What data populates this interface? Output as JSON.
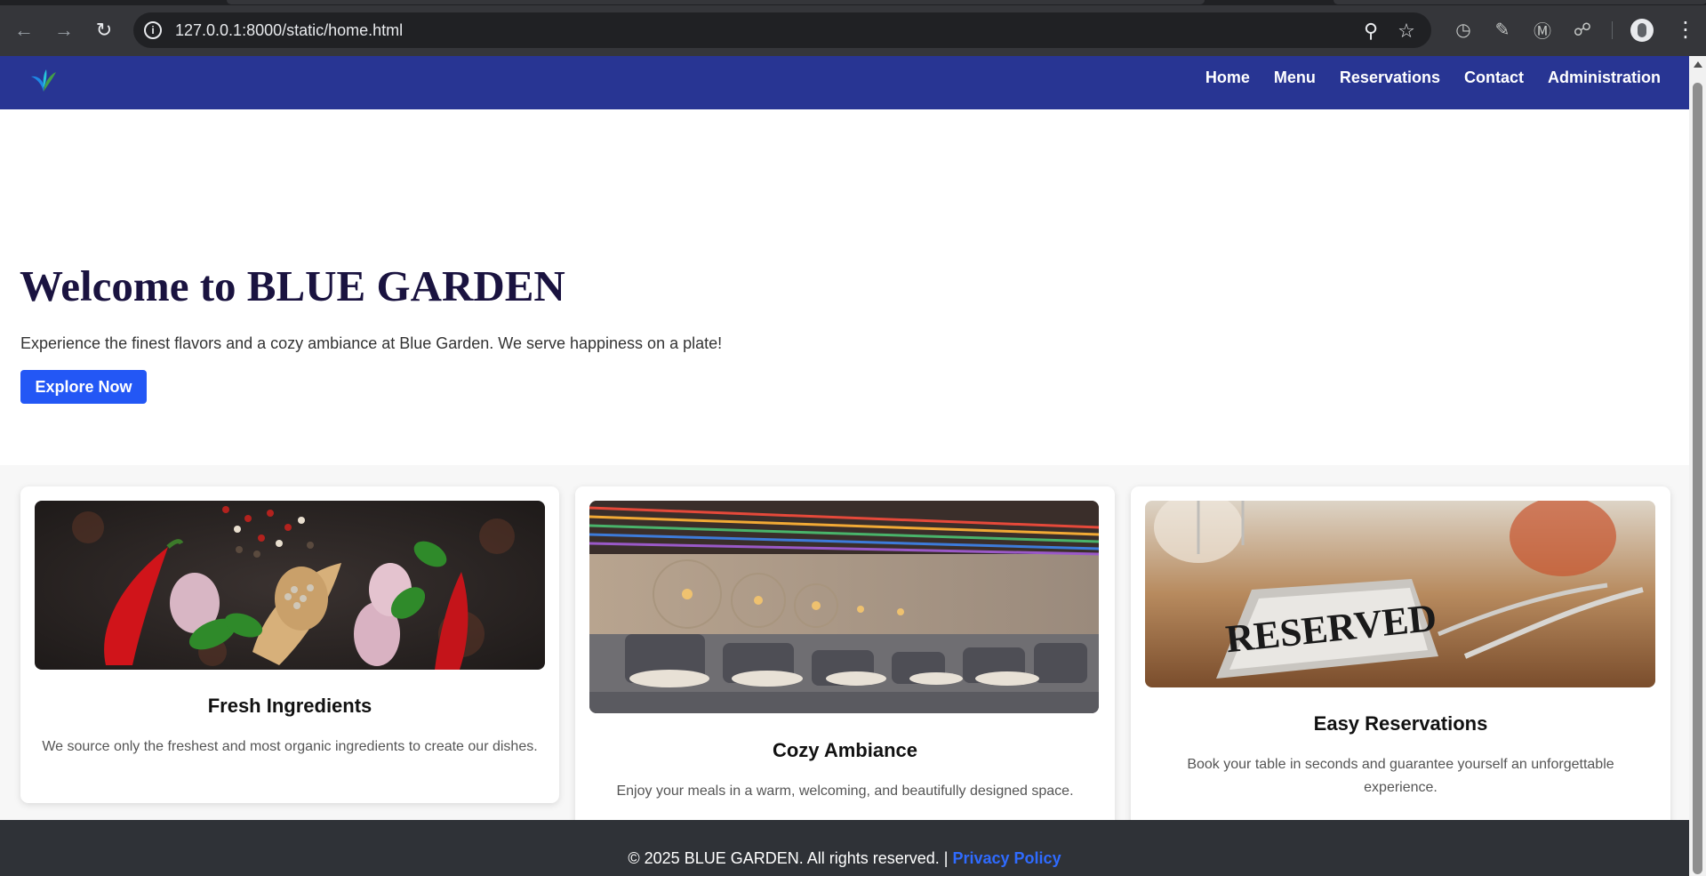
{
  "browser": {
    "url": "127.0.0.1:8000/static/home.html"
  },
  "site": {
    "nav": [
      "Home",
      "Menu",
      "Reservations",
      "Contact",
      "Administration"
    ]
  },
  "hero": {
    "title": "Welcome to BLUE GARDEN",
    "subtitle": "Experience the finest flavors and a cozy ambiance at Blue Garden. We serve happiness on a plate!",
    "cta": "Explore Now"
  },
  "features": [
    {
      "title": "Fresh Ingredients",
      "desc": "We source only the freshest and most organic ingredients to create our dishes."
    },
    {
      "title": "Cozy Ambiance",
      "desc": "Enjoy your meals in a warm, welcoming, and beautifully designed space."
    },
    {
      "title": "Easy Reservations",
      "desc": "Book your table in seconds and guarantee yourself an unforgettable experience.",
      "sign_text": "RESERVED"
    }
  ],
  "footer": {
    "text": "© 2025 BLUE GARDEN. All rights reserved. |",
    "link": "Privacy Policy"
  }
}
